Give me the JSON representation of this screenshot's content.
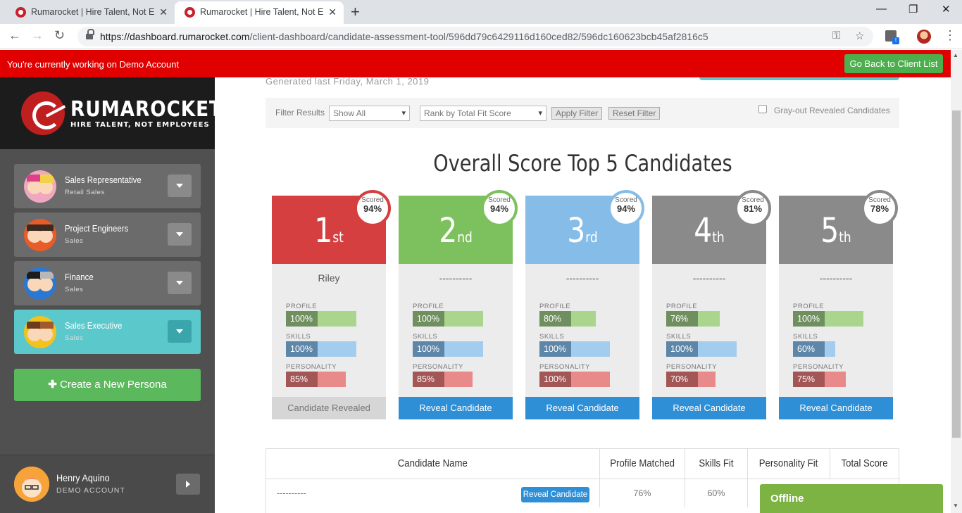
{
  "browser": {
    "tabs": [
      {
        "title": "Rumarocket | Hire Talent, Not Em",
        "active": false
      },
      {
        "title": "Rumarocket | Hire Talent, Not Em",
        "active": true
      }
    ],
    "url_host": "https://dashboard.rumarocket.com",
    "url_path": "/client-dashboard/candidate-assessment-tool/596dd79c6429116d160ced82/596dc160623bcb45af2816c5"
  },
  "banner": {
    "text": "You're currently working on Demo Account",
    "button": "Go Back to Client List"
  },
  "brand": {
    "name": "RUMAROCKET",
    "tagline": "HIRE TALENT, NOT EMPLOYEES"
  },
  "personas": [
    {
      "title": "Sales Representative",
      "subtitle": "Retail Sales",
      "active": false
    },
    {
      "title": "Project Engineers",
      "subtitle": "Sales",
      "active": false
    },
    {
      "title": "Finance",
      "subtitle": "Sales",
      "active": false
    },
    {
      "title": "Sales Executive",
      "subtitle": "Sales",
      "active": true
    }
  ],
  "create_persona": "Create a New Persona",
  "user": {
    "name": "Henry Aquino",
    "subtitle": "DEMO ACCOUNT"
  },
  "main": {
    "generated": "Generated last Friday, March 1, 2019",
    "filter": {
      "label": "Filter Results",
      "show_value": "Show All",
      "rank_value": "Rank by Total Fit Score",
      "apply": "Apply Filter",
      "reset": "Reset Filter",
      "grayout_label": "Gray-out Revealed Candidates"
    },
    "title": "Overall Score Top 5 Candidates",
    "metric_labels": {
      "profile": "PROFILE",
      "skills": "SKILLS",
      "personality": "PERSONALITY"
    },
    "cards": [
      {
        "num": "1",
        "suffix": "st",
        "color": "#d63f3f",
        "badge_label": "Scored",
        "score": "94%",
        "name": "Riley",
        "profile": "100%",
        "profile_v": 100,
        "skills": "100%",
        "skills_v": 100,
        "personality": "85%",
        "personality_v": 85,
        "action": "Candidate Revealed",
        "revealed": true
      },
      {
        "num": "2",
        "suffix": "nd",
        "color": "#7dc15e",
        "badge_label": "Scored",
        "score": "94%",
        "name": "----------",
        "profile": "100%",
        "profile_v": 100,
        "skills": "100%",
        "skills_v": 100,
        "personality": "85%",
        "personality_v": 85,
        "action": "Reveal Candidate",
        "revealed": false
      },
      {
        "num": "3",
        "suffix": "rd",
        "color": "#85bde8",
        "badge_label": "Scored",
        "score": "94%",
        "name": "----------",
        "profile": "80%",
        "profile_v": 80,
        "skills": "100%",
        "skills_v": 100,
        "personality": "100%",
        "personality_v": 100,
        "action": "Reveal Candidate",
        "revealed": false
      },
      {
        "num": "4",
        "suffix": "th",
        "color": "#8a8a8a",
        "badge_label": "Scored",
        "score": "81%",
        "name": "----------",
        "profile": "76%",
        "profile_v": 76,
        "skills": "100%",
        "skills_v": 100,
        "personality": "70%",
        "personality_v": 70,
        "action": "Reveal Candidate",
        "revealed": false
      },
      {
        "num": "5",
        "suffix": "th",
        "color": "#8a8a8a",
        "badge_label": "Scored",
        "score": "78%",
        "name": "----------",
        "profile": "100%",
        "profile_v": 100,
        "skills": "60%",
        "skills_v": 60,
        "personality": "75%",
        "personality_v": 75,
        "action": "Reveal Candidate",
        "revealed": false
      }
    ],
    "table": {
      "headers": [
        "Candidate Name",
        "Profile Matched",
        "Skills Fit",
        "Personality Fit",
        "Total Score"
      ],
      "rows": [
        {
          "name": "----------",
          "action": "Reveal Candidate",
          "profile": "76%",
          "skills": "60%"
        }
      ]
    }
  },
  "chat": {
    "status": "Offline"
  },
  "colors": {
    "profile_dark": "#6f8f5f",
    "profile_light": "#a9d58f",
    "skills_dark": "#5e86a8",
    "skills_light": "#a3cdee",
    "personality_dark": "#a35656",
    "personality_light": "#e88a8a"
  }
}
